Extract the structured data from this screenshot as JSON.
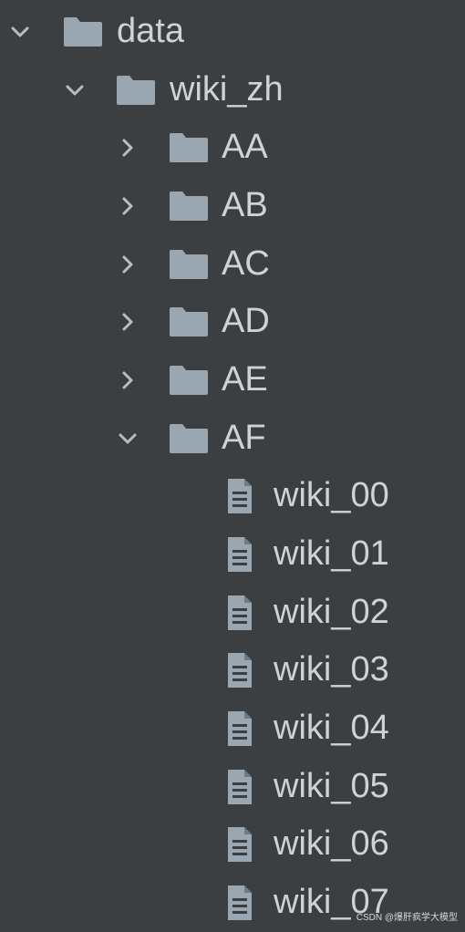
{
  "tree": {
    "root": {
      "label": "data",
      "expanded": true,
      "icon": "folder-icon"
    },
    "wiki_zh": {
      "label": "wiki_zh",
      "expanded": true,
      "icon": "folder-icon"
    },
    "folders": [
      {
        "label": "AA",
        "expanded": false,
        "icon": "folder-icon"
      },
      {
        "label": "AB",
        "expanded": false,
        "icon": "folder-icon"
      },
      {
        "label": "AC",
        "expanded": false,
        "icon": "folder-icon"
      },
      {
        "label": "AD",
        "expanded": false,
        "icon": "folder-icon"
      },
      {
        "label": "AE",
        "expanded": false,
        "icon": "folder-icon"
      },
      {
        "label": "AF",
        "expanded": true,
        "icon": "folder-icon"
      }
    ],
    "files": [
      {
        "label": "wiki_00",
        "icon": "file-text-icon"
      },
      {
        "label": "wiki_01",
        "icon": "file-text-icon"
      },
      {
        "label": "wiki_02",
        "icon": "file-text-icon"
      },
      {
        "label": "wiki_03",
        "icon": "file-text-icon"
      },
      {
        "label": "wiki_04",
        "icon": "file-text-icon"
      },
      {
        "label": "wiki_05",
        "icon": "file-text-icon"
      },
      {
        "label": "wiki_06",
        "icon": "file-text-icon"
      },
      {
        "label": "wiki_07",
        "icon": "file-text-icon"
      }
    ]
  },
  "watermark": "CSDN @爆肝疯学大模型",
  "colors": {
    "background": "#3c3f41",
    "text": "#cfd3d6",
    "icon": "#9aa7b0",
    "chevron": "#b8bec3"
  }
}
